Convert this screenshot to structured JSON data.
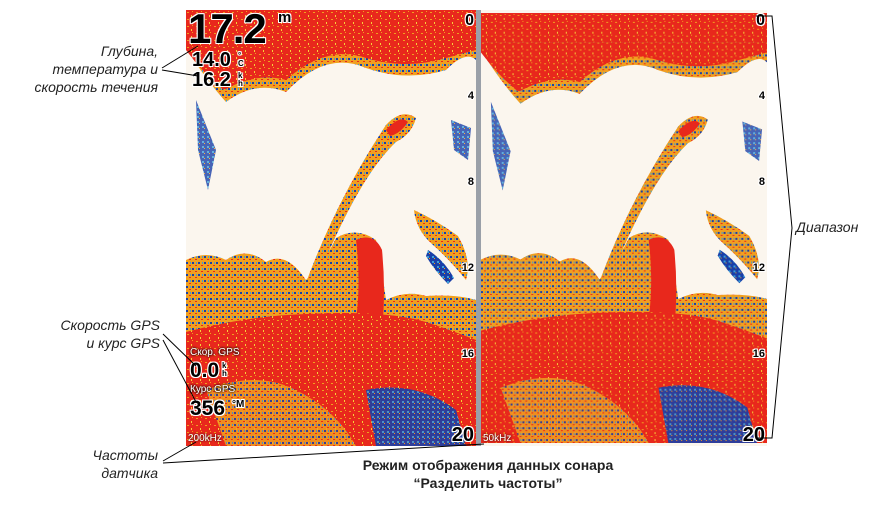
{
  "callouts": {
    "depth_temp_speed": [
      "Глубина,",
      "температура и",
      "скорость течения"
    ],
    "gps_speed_course": [
      "Скорость GPS",
      "и курс GPS"
    ],
    "transducer_freq": [
      "Частоты",
      "датчика"
    ],
    "range": "Диапазон"
  },
  "caption": [
    "Режим отображения данных сонара",
    "“Разделить частоты”"
  ],
  "left_panel": {
    "depth_value": "17.2",
    "depth_unit": "m",
    "temperature_value": "14.0",
    "temperature_unit": [
      "°",
      "C"
    ],
    "current_speed_value": "16.2",
    "current_speed_unit": [
      "k",
      "h"
    ],
    "gps_speed_label": "Скор. GPS",
    "gps_speed_value": "0.0",
    "gps_speed_unit": [
      "k",
      "h"
    ],
    "gps_course_label": "Курс GPS",
    "gps_course_value": "356",
    "gps_course_unit": "°M",
    "frequency": "200kHz"
  },
  "right_panel": {
    "frequency": "50kHz"
  },
  "depth_scale": [
    "0",
    "4",
    "8",
    "12",
    "16",
    "20"
  ],
  "colors": {
    "strong_return": "#e8281c",
    "medium_return": "#f0a020",
    "weak_return": "#1a3fa8",
    "background": "#fbf6ee",
    "divider": "#9aa0a8"
  }
}
